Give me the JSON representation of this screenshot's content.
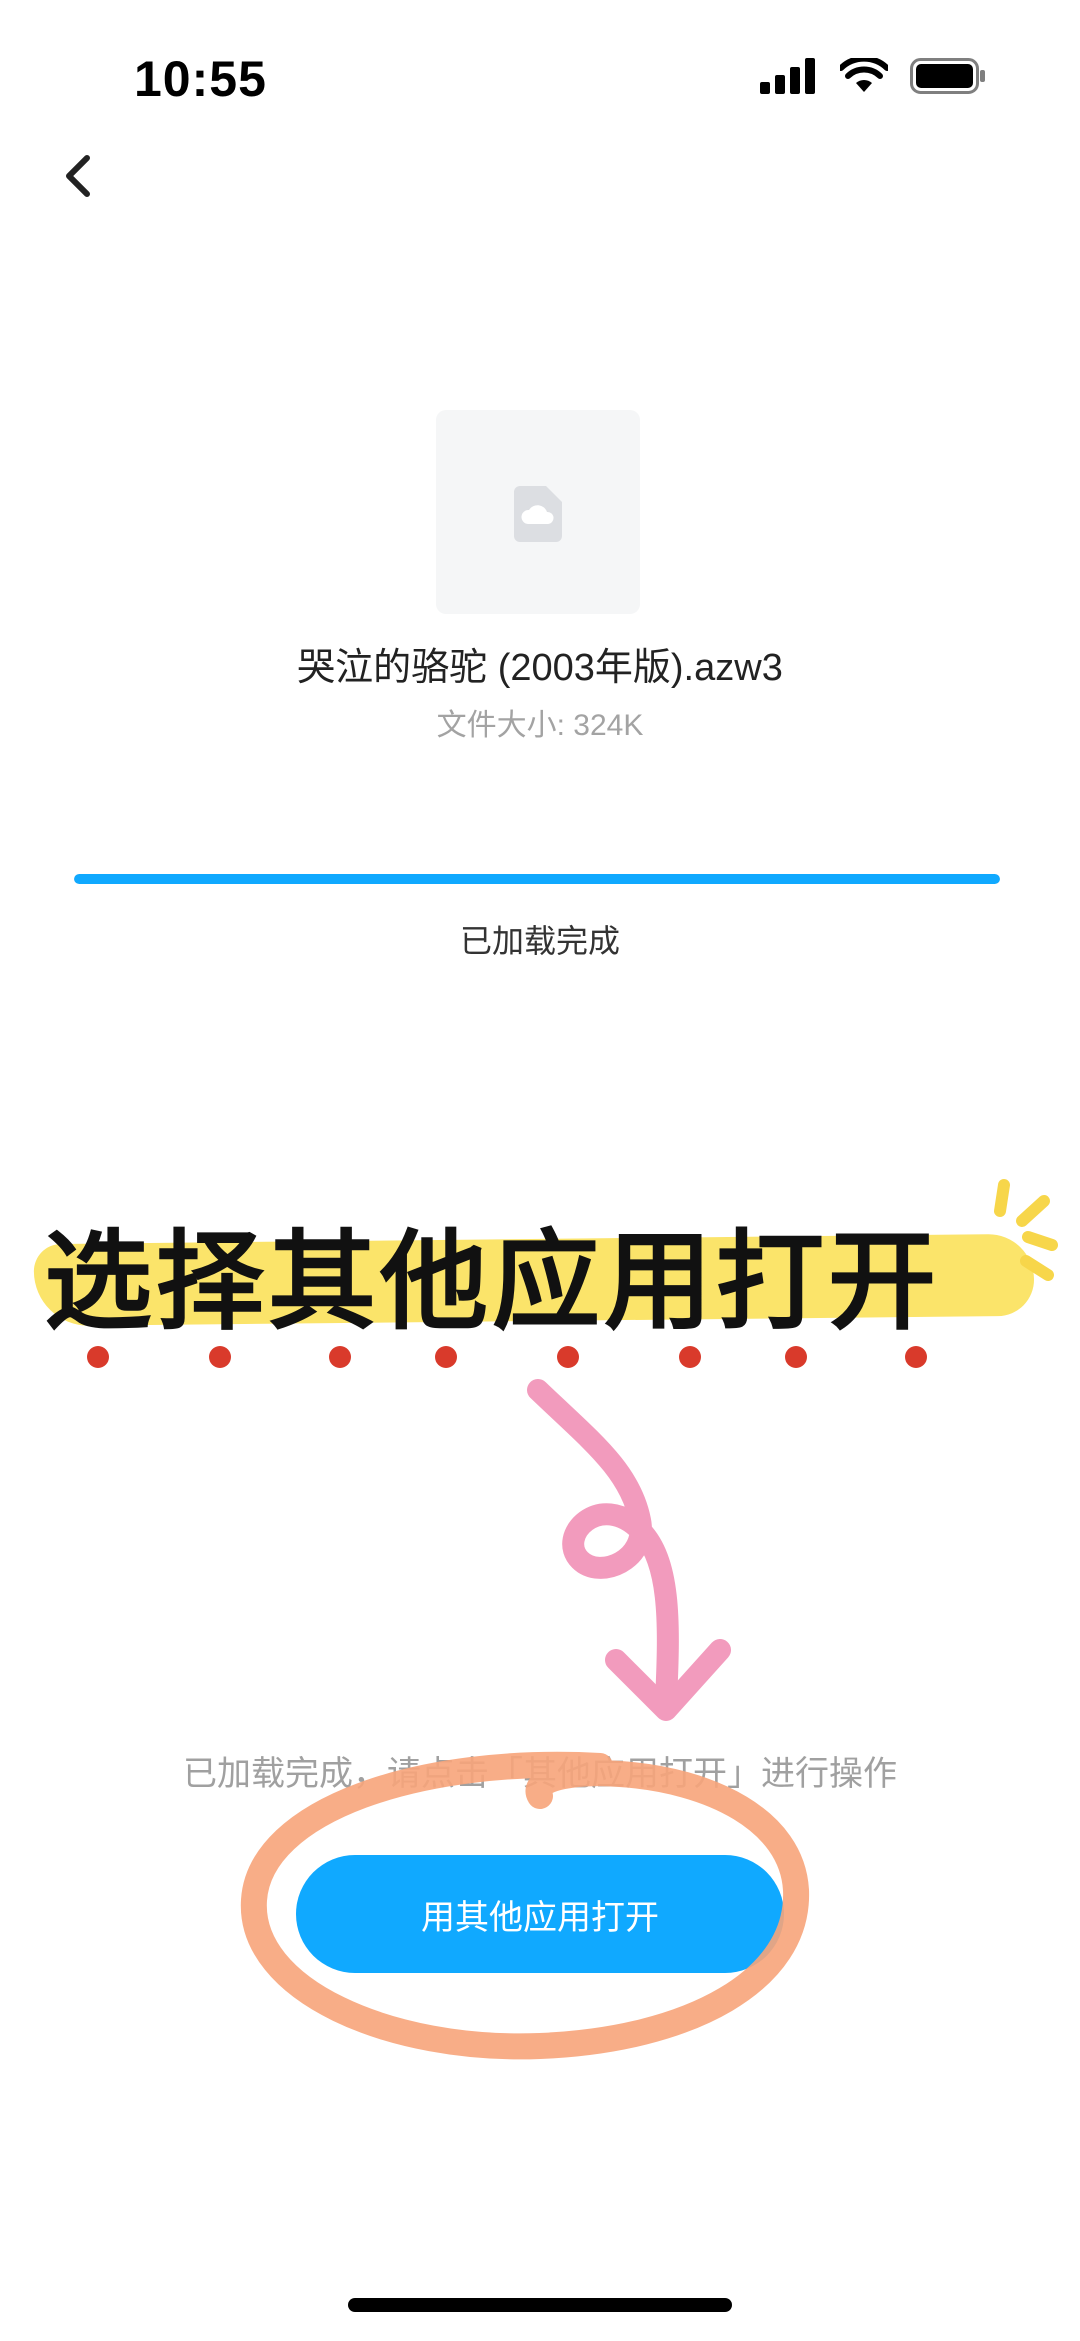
{
  "status_bar": {
    "time": "10:55",
    "icons": [
      "cellular-signal-icon",
      "wifi-icon",
      "battery-icon"
    ]
  },
  "nav": {
    "back_icon": "chevron-left-icon"
  },
  "file": {
    "icon": "cloud-document-icon",
    "name": "哭泣的骆驼 (2003年版).azw3",
    "size_label": "文件大小: 324K"
  },
  "progress": {
    "fraction": 1.0,
    "status": "已加载完成"
  },
  "annotation": {
    "title": "选择其他应用打开"
  },
  "hint": "已加载完成，请点击「其他应用打开」进行操作",
  "actions": {
    "open_with_other_app": "用其他应用打开"
  },
  "colors": {
    "accent": "#10a9ff",
    "highlight_yellow": "#fbe46a",
    "dot_red": "#d93a2b",
    "arrow_pink": "#f29bbd",
    "circle_orange": "#f7a47a"
  }
}
